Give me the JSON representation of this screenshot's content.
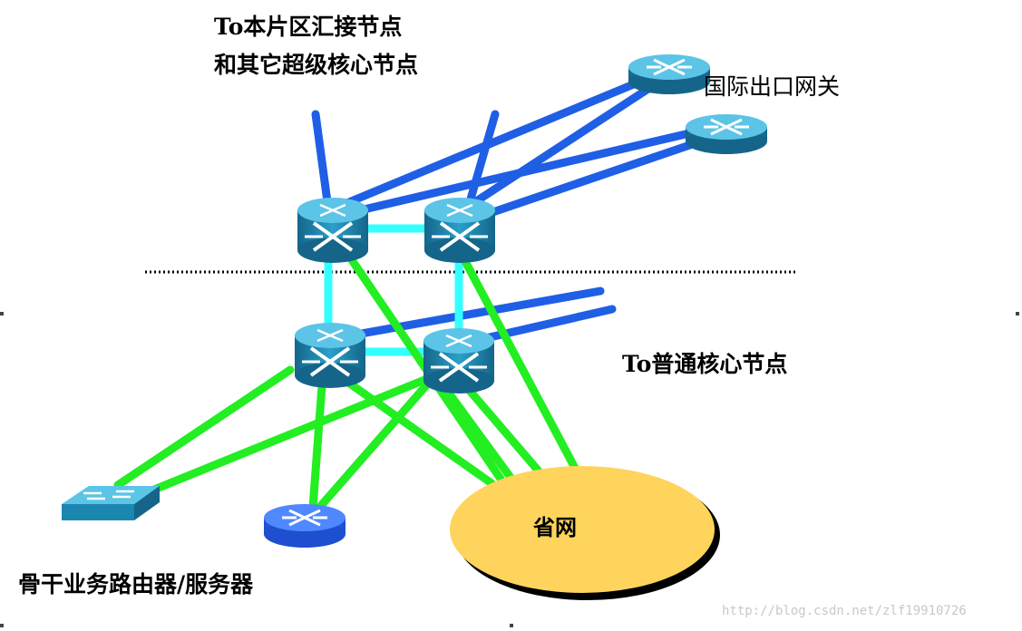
{
  "labels": {
    "top_line1": "To本片区汇接节点",
    "top_line2": "和其它超级核心节点",
    "gateway": "国际出口网关",
    "normal_core": "To普通核心节点",
    "provincial": "省网",
    "backbone": "骨干业务路由器/服务器",
    "watermark": "http://blog.csdn.net/zlf19910726"
  },
  "colors": {
    "uplink": "#1f5fe6",
    "core_link": "#33ffff",
    "access_link": "#22ee22",
    "router_body": "#1b7fa6",
    "router_top": "#2aa0c8",
    "provincial_fill": "#ffd45c"
  },
  "icons": [
    "switch-router-icon",
    "router-icon",
    "workgroup-switch-icon",
    "cloud-ellipse"
  ]
}
